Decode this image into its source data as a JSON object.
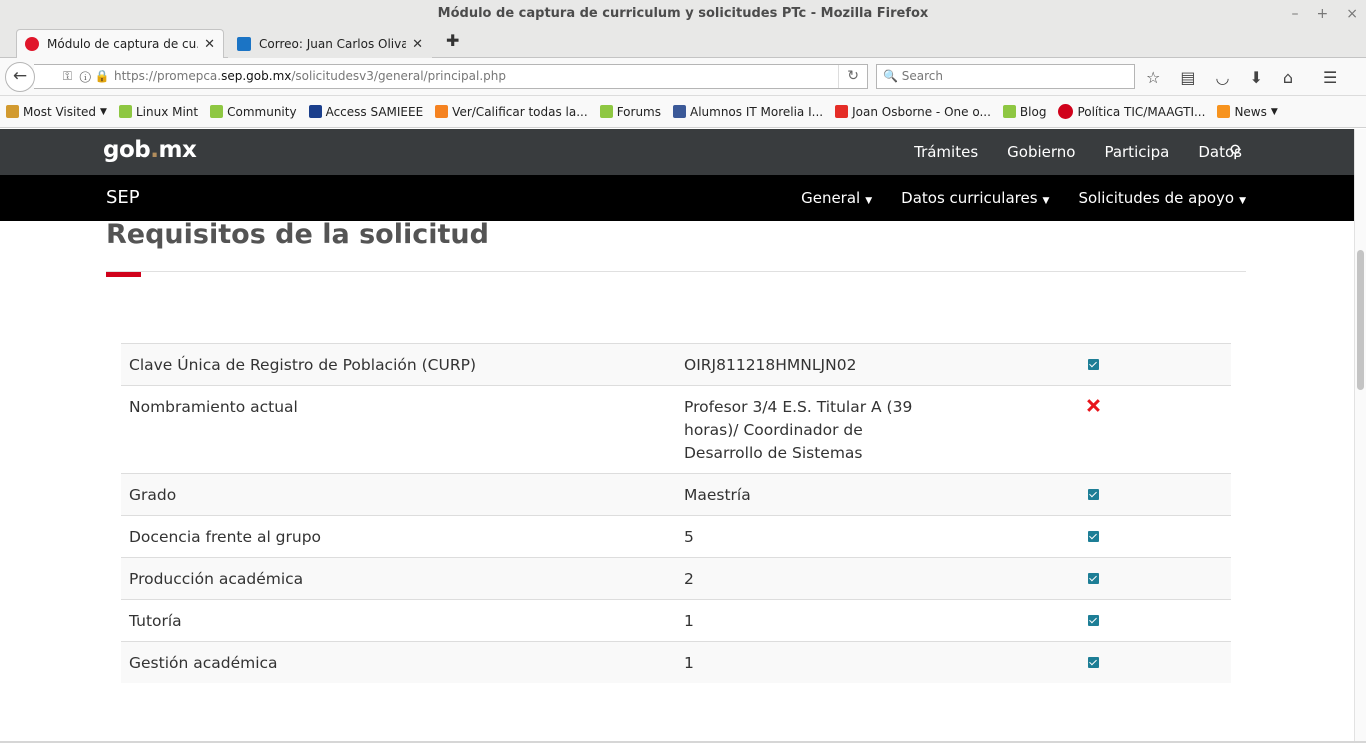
{
  "window": {
    "title": "Módulo de captura de curriculum y solicitudes PTc - Mozilla Firefox"
  },
  "tabs": [
    {
      "label": "Módulo de captura de cu...",
      "color": "#e0162b"
    },
    {
      "label": "Correo: Juan Carlos Oliva...",
      "color": "#1b74c5"
    }
  ],
  "nav": {
    "url_prefix": "https://promepca.",
    "url_domain": "sep.gob.mx",
    "url_path": "/solicitudesv3/general/principal.php",
    "search_placeholder": "Search"
  },
  "bookmarks": [
    {
      "label": "Most Visited",
      "icon": "folder-icon",
      "dropdown": true
    },
    {
      "label": "Linux Mint",
      "icon": "mint-icon"
    },
    {
      "label": "Community",
      "icon": "mint-icon"
    },
    {
      "label": "Access SAMIEEE",
      "icon": "ieee-icon"
    },
    {
      "label": "Ver/Calificar todas la...",
      "icon": "moodle-icon"
    },
    {
      "label": "Forums",
      "icon": "mint-icon"
    },
    {
      "label": "Alumnos IT Morelia I...",
      "icon": "facebook-icon"
    },
    {
      "label": "Joan Osborne - One o...",
      "icon": "youtube-icon"
    },
    {
      "label": "Blog",
      "icon": "mint-icon"
    },
    {
      "label": "Política TIC/MAAGTI...",
      "icon": "red-circle-icon"
    },
    {
      "label": "News",
      "icon": "rss-icon",
      "dropdown": true
    }
  ],
  "gob": {
    "logo_left": "gob",
    "logo_dot": ".",
    "logo_right": "mx",
    "nav": [
      "Trámites",
      "Gobierno",
      "Participa",
      "Datos"
    ]
  },
  "sep": {
    "title": "SEP",
    "nav": [
      "General",
      "Datos curriculares",
      "Solicitudes de apoyo"
    ]
  },
  "main": {
    "heading": "Requisitos de la solicitud",
    "rows": [
      {
        "label": "Clave Única de Registro de Población (CURP)",
        "value": "OIRJ811218HMNLJN02",
        "status": "ok"
      },
      {
        "label": "Nombramiento actual",
        "value": "Profesor 3/4 E.S. Titular A (39 horas)/ Coordinador de Desarrollo de Sistemas",
        "status": "fail"
      },
      {
        "label": "Grado",
        "value": "Maestría",
        "status": "ok"
      },
      {
        "label": "Docencia frente al grupo",
        "value": "5",
        "status": "ok"
      },
      {
        "label": "Producción académica",
        "value": "2",
        "status": "ok"
      },
      {
        "label": "Tutoría",
        "value": "1",
        "status": "ok"
      },
      {
        "label": "Gestión académica",
        "value": "1",
        "status": "ok"
      }
    ]
  }
}
